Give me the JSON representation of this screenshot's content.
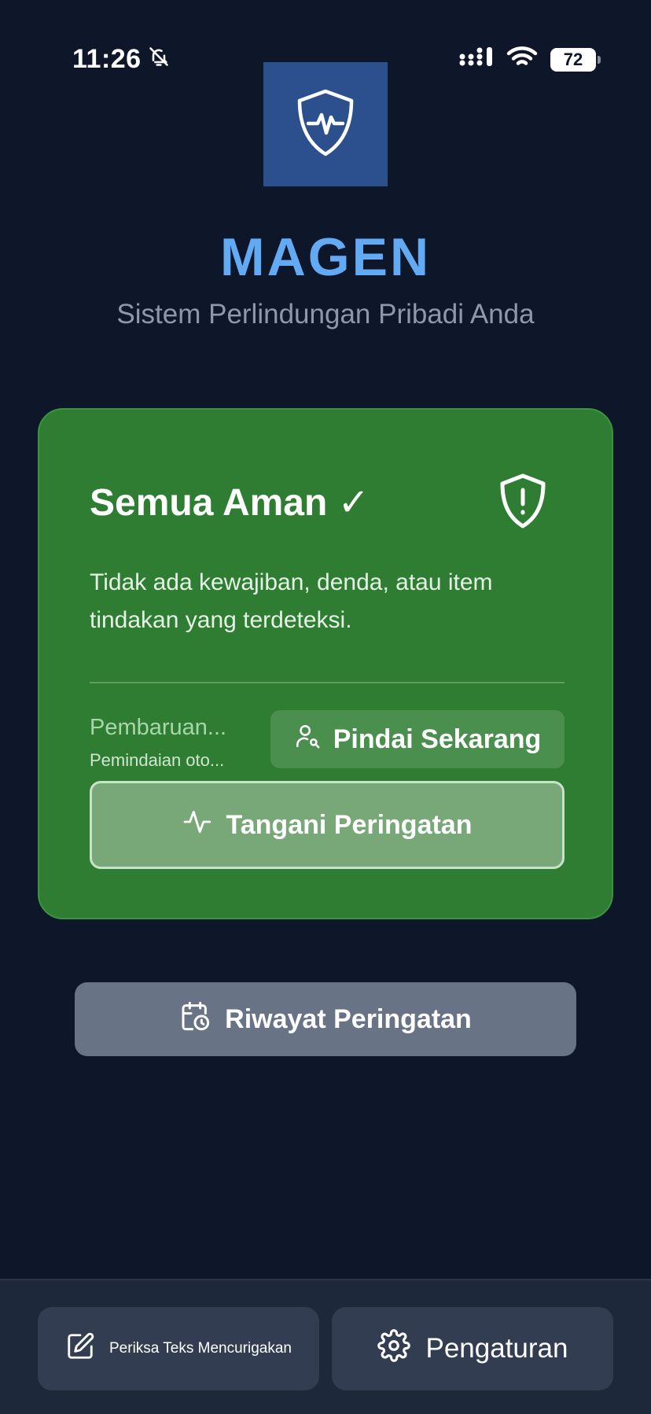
{
  "status_bar": {
    "time": "11:26",
    "battery": "72",
    "icons": [
      "bell-muted-icon",
      "signal-icon",
      "wifi-icon",
      "battery-icon"
    ]
  },
  "header": {
    "title": "MAGEN",
    "subtitle": "Sistem Perlindungan Pribadi Anda",
    "logo_icon": "shield-heartbeat-icon"
  },
  "status_card": {
    "title": "Semua Aman ✓",
    "description": "Tidak ada kewajiban, denda, atau item tindakan yang terdeteksi.",
    "update_title": "Pembaruan...",
    "update_subtitle": "Pemindaian oto...",
    "scan_button_label": "Pindai Sekarang",
    "handle_button_label": "Tangani Peringatan",
    "shield_icon": "shield-alert-icon"
  },
  "history_button_label": "Riwayat Peringatan",
  "bottom_bar": {
    "check_text_label": "Periksa Teks Mencurigakan",
    "settings_label": "Pengaturan"
  },
  "colors": {
    "background": "#0e1729",
    "accent": "#63aaf5",
    "card_green": "#2e7d32",
    "logo_blue": "#2c4f8e"
  }
}
